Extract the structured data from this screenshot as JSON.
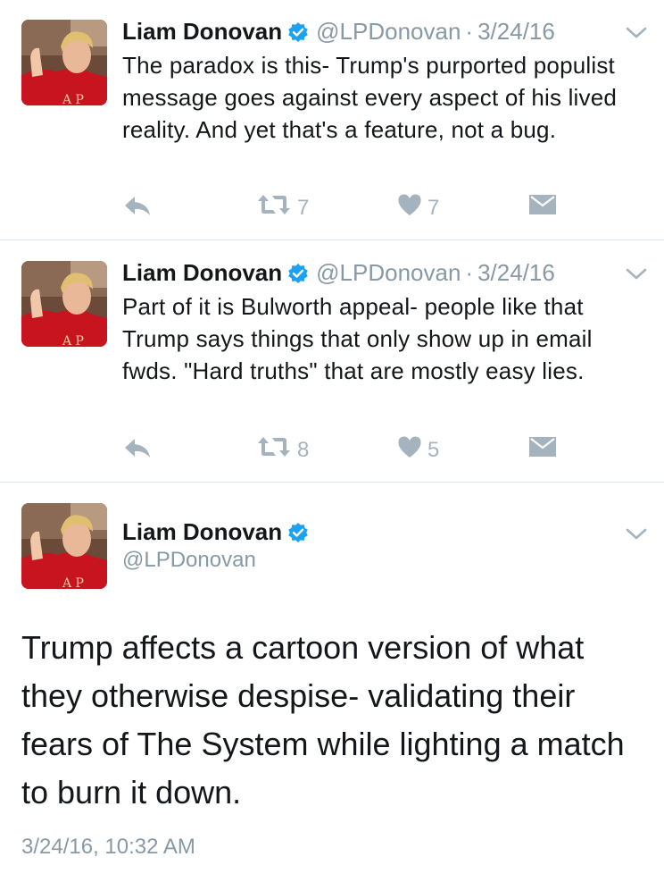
{
  "tweets": [
    {
      "name": "Liam Donovan",
      "handle": "@LPDonovan",
      "separator": "·",
      "date": "3/24/16",
      "text": "The paradox is this- Trump's purported populist message goes against every aspect of his lived reality. And yet that's a feature, not a bug.",
      "retweets": "7",
      "likes": "7"
    },
    {
      "name": "Liam Donovan",
      "handle": "@LPDonovan",
      "separator": "·",
      "date": "3/24/16",
      "text": "Part of it is Bulworth appeal- people like that Trump says things that only show up in email fwds. \"Hard truths\" that are mostly easy lies.",
      "retweets": "8",
      "likes": "5"
    }
  ],
  "main_tweet": {
    "name": "Liam Donovan",
    "handle": "@LPDonovan",
    "text": "Trump affects a cartoon version of what they otherwise despise- validating their fears of The System while lighting a match to burn it down.",
    "timestamp": "3/24/16, 10:32 AM"
  },
  "icons": {
    "reply": "reply-icon",
    "retweet": "retweet-icon",
    "like": "heart-icon",
    "message": "direct-message-icon",
    "more": "chevron-down-icon",
    "verified": "verified-badge-icon"
  },
  "colors": {
    "text": "#14171a",
    "muted": "#8899a6",
    "action": "#a5b3bf",
    "verified": "#1da1f2",
    "divider": "#e1e8ed"
  }
}
